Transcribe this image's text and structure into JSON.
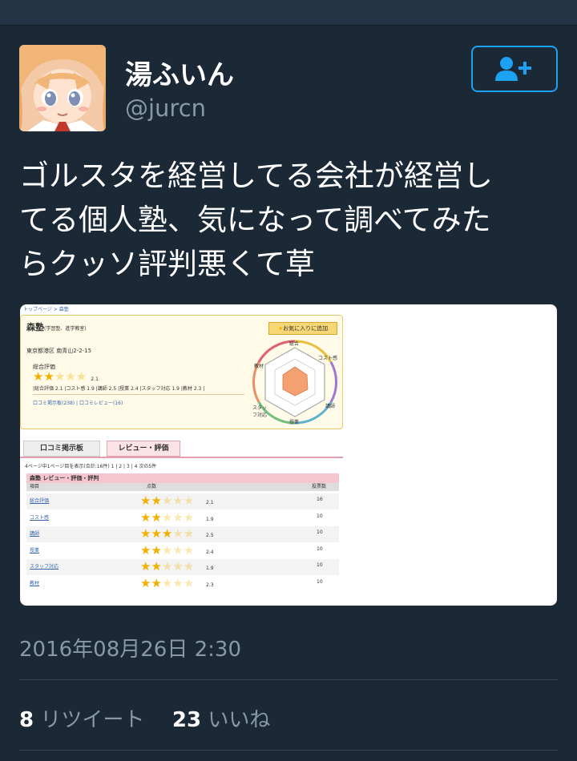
{
  "profile": {
    "display_name": "湯ふいん",
    "handle": "@jurcn"
  },
  "tweet": {
    "lines": [
      "ゴルスタを経営してる会社が経営し",
      "てる個人塾、気になって調べてみた",
      "らクッソ評判悪くて草"
    ]
  },
  "media": {
    "breadcrumb": "トップページ > 森塾",
    "school_name": "森塾",
    "school_type": "(学習塾、進学教室)",
    "favorite_button": "お気に入りに追加",
    "address": "東京都港区 南青山2-2-15",
    "overall_label": "総合評価",
    "overall_score": "2.1",
    "score_summary": "|総合評価 2.1 |コスト感 1.9 |講師 2.5 |授業 2.4 |スタッフ対応 1.9 |教材 2.3 |",
    "links": "口コミ掲示板(238) | 口コミレビュー(16)",
    "radar_labels": [
      "総合",
      "コスト感",
      "講師",
      "授業",
      "スタッフ対応",
      "教材"
    ],
    "tab_board": "口コミ掲示板",
    "tab_review": "レビュー・評価",
    "paging": "4ページ中1ページ目を表示(合計:16件) 1 | 2 | 3 | 4 次の5件",
    "table_title": "森塾 レビュー・評価・評判",
    "col_item": "項目",
    "col_score": "点数",
    "col_votes": "投票数",
    "rows": [
      {
        "label": "総合評価",
        "score": "2.1",
        "votes": "16",
        "rating": 2.1
      },
      {
        "label": "コスト感",
        "score": "1.9",
        "votes": "10",
        "rating": 1.9
      },
      {
        "label": "講師",
        "score": "2.5",
        "votes": "10",
        "rating": 2.5
      },
      {
        "label": "授業",
        "score": "2.4",
        "votes": "10",
        "rating": 2.4
      },
      {
        "label": "スタッフ対応",
        "score": "1.9",
        "votes": "10",
        "rating": 1.9
      },
      {
        "label": "教材",
        "score": "2.3",
        "votes": "10",
        "rating": 2.3
      }
    ]
  },
  "timestamp": "2016年08月26日 2:30",
  "stats": {
    "retweets_count": "8",
    "retweets_label": "リツイート",
    "likes_count": "23",
    "likes_label": "いいね"
  },
  "colors": {
    "background": "#1b2836",
    "accent": "#1da1f2",
    "muted_text": "#8899a6"
  },
  "icons": {
    "follow": "add-user-icon"
  }
}
